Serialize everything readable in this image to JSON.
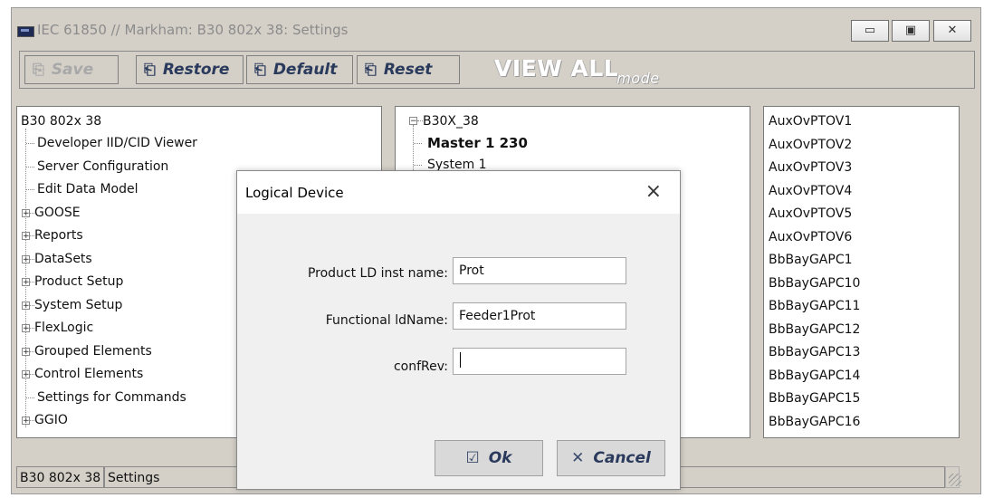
{
  "window": {
    "title": "IEC 61850 // Markham: B30 802x 38: Settings",
    "minimize_glyph": "▭",
    "maximize_glyph": "▣",
    "close_glyph": "✕"
  },
  "toolbar": {
    "save_label": "Save",
    "restore_label": "Restore",
    "default_label": "Default",
    "reset_label": "Reset",
    "view_all_text": "VIEW ALL",
    "mode_text": "mode"
  },
  "left_tree": {
    "root": "B30 802x 38",
    "items": [
      {
        "label": "Developer IID/CID Viewer",
        "expandable": false
      },
      {
        "label": "Server Configuration",
        "expandable": false
      },
      {
        "label": "Edit Data Model",
        "expandable": false
      },
      {
        "label": "GOOSE",
        "expandable": true
      },
      {
        "label": "Reports",
        "expandable": true
      },
      {
        "label": "DataSets",
        "expandable": true
      },
      {
        "label": "Product Setup",
        "expandable": true
      },
      {
        "label": "System Setup",
        "expandable": true
      },
      {
        "label": "FlexLogic",
        "expandable": true
      },
      {
        "label": "Grouped Elements",
        "expandable": true
      },
      {
        "label": "Control Elements",
        "expandable": true
      },
      {
        "label": "Settings for Commands",
        "expandable": false
      },
      {
        "label": "GGIO",
        "expandable": true
      }
    ]
  },
  "mid_tree": {
    "root": "B30X_38",
    "items": [
      {
        "label": "Master  1 230",
        "bold": true
      },
      {
        "label": "System  1",
        "bold": false
      }
    ]
  },
  "right_list": {
    "items": [
      "AuxOvPTOV1",
      "AuxOvPTOV2",
      "AuxOvPTOV3",
      "AuxOvPTOV4",
      "AuxOvPTOV5",
      "AuxOvPTOV6",
      "BbBayGAPC1",
      "BbBayGAPC10",
      "BbBayGAPC11",
      "BbBayGAPC12",
      "BbBayGAPC13",
      "BbBayGAPC14",
      "BbBayGAPC15",
      "BbBayGAPC16"
    ]
  },
  "statusbar": {
    "device": "B30 802x 38",
    "section": "Settings"
  },
  "dialog": {
    "title": "Logical Device",
    "close_glyph": "×",
    "product_ld_label": "Product LD inst name:",
    "product_ld_value": "Prot",
    "functional_label": "Functional ldName:",
    "functional_value": "Feeder1Prot",
    "confrev_label": "confRev:",
    "confrev_value": "",
    "ok_label": "Ok",
    "cancel_label": "Cancel"
  }
}
